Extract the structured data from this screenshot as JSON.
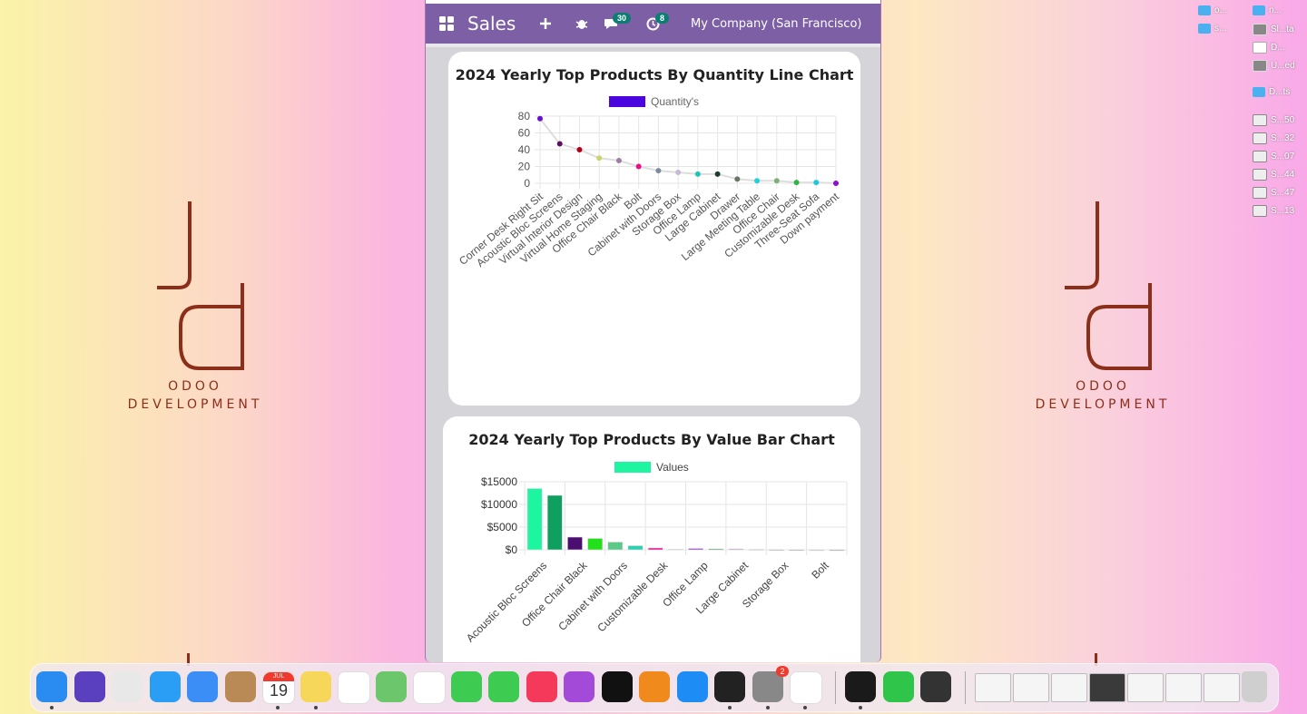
{
  "app": {
    "title": "Sales",
    "company": "My Company (San Francisco)",
    "messages_count": "30",
    "activities_count": "8"
  },
  "wallpaper": {
    "logo_line1": "ODOO",
    "logo_line2": "DEVELOPMENT"
  },
  "desktop_files": [
    {
      "label": "o...",
      "icon": "folder"
    },
    {
      "label": "n...",
      "icon": "folder"
    },
    {
      "label": "s...",
      "icon": "folder"
    },
    {
      "label": "Sl...ta",
      "icon": "image"
    },
    {
      "label": "D...",
      "icon": "document"
    },
    {
      "label": "U...ed",
      "icon": "image"
    },
    {
      "label": "D...ts",
      "icon": "folder"
    },
    {
      "label": "S...50",
      "icon": "screenshot"
    },
    {
      "label": "S...32",
      "icon": "screenshot"
    },
    {
      "label": "S...07",
      "icon": "screenshot"
    },
    {
      "label": "S...44",
      "icon": "screenshot"
    },
    {
      "label": "S...47",
      "icon": "screenshot"
    },
    {
      "label": "S...13",
      "icon": "screenshot"
    }
  ],
  "chart_data": [
    {
      "type": "line",
      "title": "2024 Yearly Top Products By Quantity Line Chart",
      "legend": "Quantity's",
      "legend_color": "#4b06e0",
      "ylim": [
        0,
        80
      ],
      "yticks": [
        "80",
        "60",
        "40",
        "20",
        "0"
      ],
      "categories": [
        "Corner Desk Right Sit",
        "Acoustic Bloc Screens",
        "Virtual Interior Design",
        "Virtual Home Staging",
        "Office Chair Black",
        "Bolt",
        "Cabinet with Doors",
        "Storage Box",
        "Office Lamp",
        "Large Cabinet",
        "Drawer",
        "Large Meeting Table",
        "Office Chair",
        "Customizable Desk",
        "Three-Seat Sofa",
        "Down payment"
      ],
      "values": [
        77,
        47,
        40,
        30,
        27,
        20,
        15,
        13,
        11,
        11,
        5,
        3,
        3,
        1,
        1,
        0
      ],
      "point_colors": [
        "#6a0fd1",
        "#5c1060",
        "#b0001a",
        "#c9d46a",
        "#9c7fa5",
        "#ee0a88",
        "#7f8aa0",
        "#c8b8d6",
        "#1ec6b7",
        "#1d3a2a",
        "#667766",
        "#22d1d8",
        "#7fb07a",
        "#2fb44a",
        "#20c6dc",
        "#8a0fcf"
      ]
    },
    {
      "type": "bar",
      "title": "2024 Yearly Top Products By Value Bar Chart",
      "legend": "Values",
      "legend_color": "#1ef5a0",
      "ylim": [
        0,
        15000
      ],
      "yticks": [
        "$15000",
        "$10000",
        "$5000",
        "$0"
      ],
      "categories": [
        "Acoustic Bloc Screens",
        "Office Chair Black",
        "Cabinet with Doors",
        "Customizable Desk",
        "Office Lamp",
        "Large Cabinet",
        "Storage Box",
        "Bolt"
      ],
      "shown_tick_labels": [
        "Acoustic Bloc Screens",
        "Office Chair Black",
        "Cabinet with Doors",
        "Customizable Desk",
        "Office Lamp",
        "Large Cabinet",
        "Storage Box",
        "Bolt"
      ],
      "values": [
        13500,
        12000,
        2800,
        2500,
        1700,
        900,
        400,
        150,
        300,
        200,
        200,
        100,
        50,
        30,
        20,
        10
      ],
      "bar_colors": [
        "#1ef5a0",
        "#0fa060",
        "#4a0d70",
        "#22e01a",
        "#5cc88a",
        "#2bd0b0",
        "#ee0a88",
        "#dddddd",
        "#9a3fd0",
        "#228a4a",
        "#c080d0",
        "#cccccc",
        "#aaaaaa",
        "#999999",
        "#bbbbbb",
        "#888888"
      ]
    }
  ],
  "dock": {
    "calendar_month": "JUL",
    "calendar_day": "19",
    "settings_badge": "2"
  }
}
